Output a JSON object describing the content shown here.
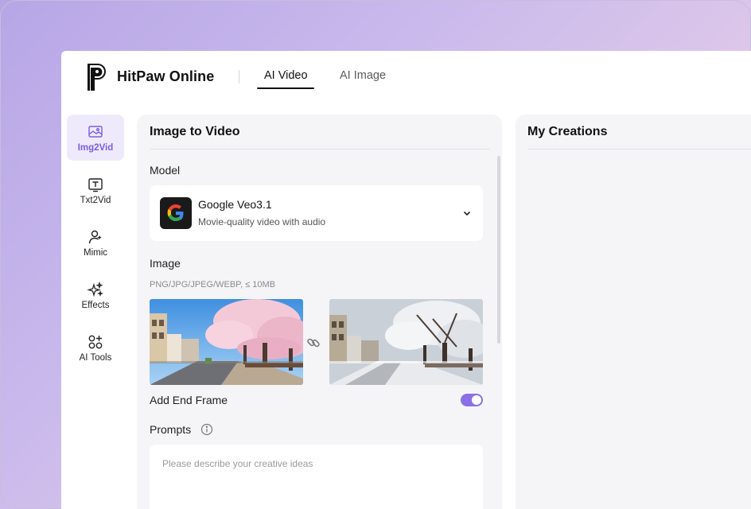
{
  "header": {
    "brand": "HitPaw Online",
    "tabs": [
      {
        "label": "AI Video",
        "active": true
      },
      {
        "label": "AI Image",
        "active": false
      }
    ]
  },
  "sidebar": {
    "items": [
      {
        "label": "Img2Vid",
        "icon": "image-icon",
        "active": true
      },
      {
        "label": "Txt2Vid",
        "icon": "text-box-icon",
        "active": false
      },
      {
        "label": "Mimic",
        "icon": "person-icon",
        "active": false
      },
      {
        "label": "Effects",
        "icon": "sparkle-icon",
        "active": false
      },
      {
        "label": "AI Tools",
        "icon": "tools-grid-icon",
        "active": false
      }
    ]
  },
  "panel": {
    "title": "Image to Video",
    "model_label": "Model",
    "model": {
      "name": "Google Veo3.1",
      "description": "Movie-quality video with audio",
      "icon": "google-icon"
    },
    "image_label": "Image",
    "image_hint": "PNG/JPG/JPEG/WEBP, ≤ 10MB",
    "end_frame_label": "Add End Frame",
    "end_frame_enabled": true,
    "prompts_label": "Prompts",
    "prompt_placeholder": "Please describe your creative ideas"
  },
  "creations": {
    "title": "My Creations"
  },
  "colors": {
    "accent": "#8b6fe8",
    "active_bg": "#efeafb",
    "panel_bg": "#f5f5f8"
  }
}
